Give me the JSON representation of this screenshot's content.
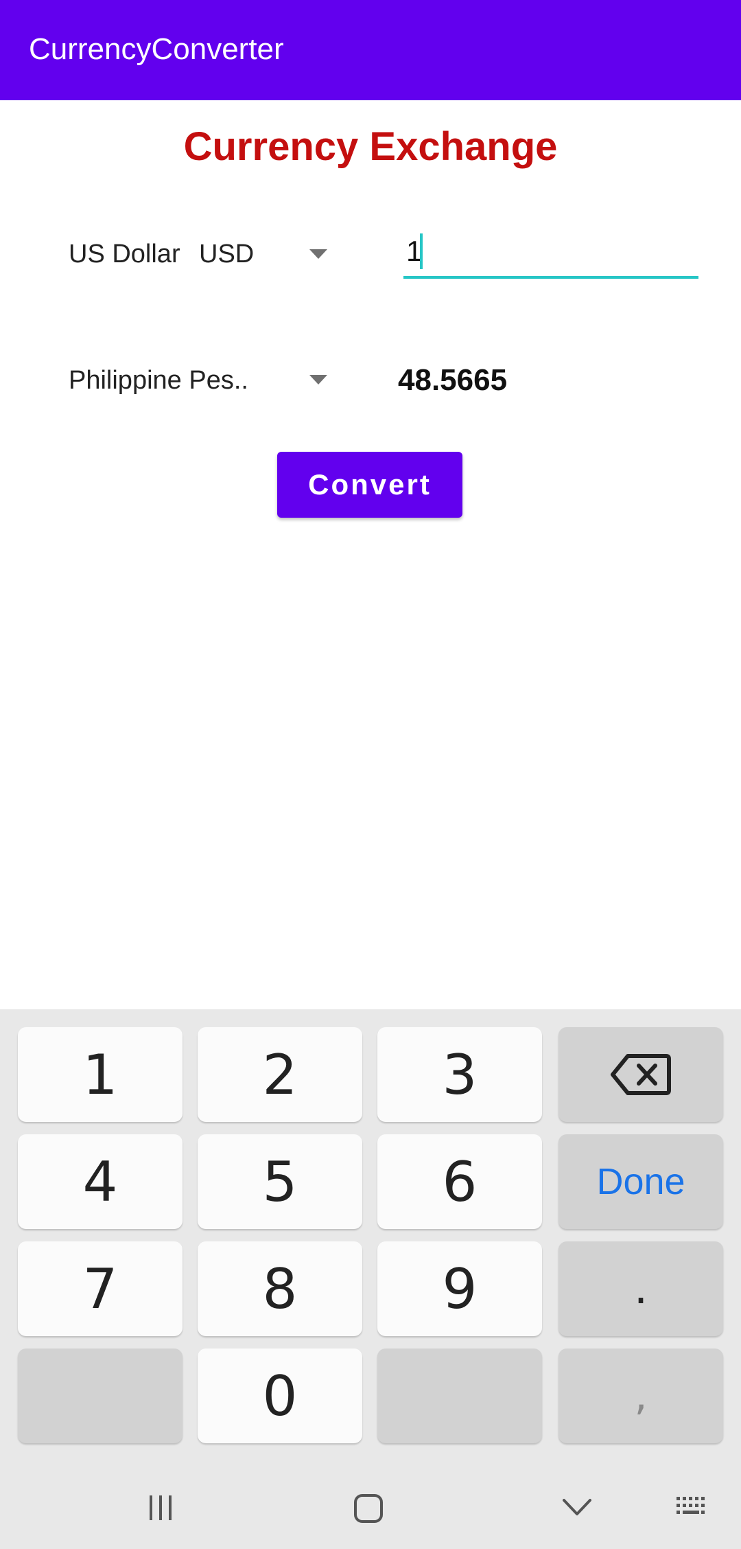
{
  "appbar": {
    "title": "CurrencyConverter"
  },
  "heading": "Currency Exchange",
  "from": {
    "currency_name": "US Dollar",
    "currency_code": "USD",
    "amount": "1"
  },
  "to": {
    "currency_name": "Philippine Pes..",
    "result": "48.5665"
  },
  "convert_label": "Convert",
  "keyboard": {
    "keys": [
      "1",
      "2",
      "3",
      "4",
      "5",
      "6",
      "7",
      "8",
      "9",
      "0"
    ],
    "done_label": "Done",
    "period": ".",
    "comma": ","
  },
  "colors": {
    "primary": "#6200ee",
    "heading": "#c40f0f",
    "accent": "#26c6c6",
    "done": "#1a73e8"
  }
}
